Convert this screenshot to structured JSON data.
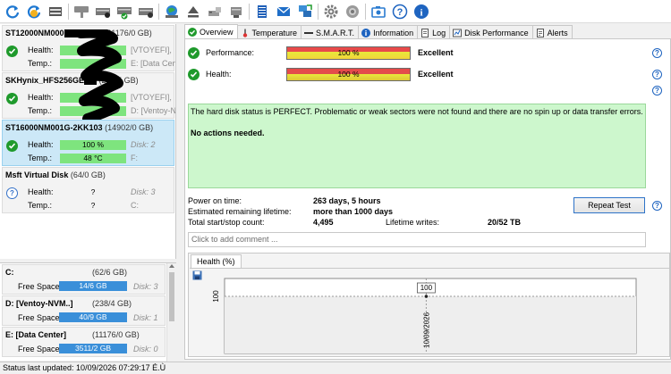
{
  "toolbar": {
    "icons": [
      "refresh-icon",
      "refresh-selected-icon",
      "drive-icon",
      "spindown-icon",
      "drive-ok-icon",
      "drive-check-icon",
      "drive-eject-icon",
      "globe-drive-icon",
      "eject-icon",
      "usb-drive-icon",
      "network-drive-icon",
      "notepad-icon",
      "mail-icon",
      "network-icon",
      "settings-icon",
      "speaker-icon",
      "screenshot-icon",
      "help-icon",
      "info-icon"
    ]
  },
  "disks": [
    {
      "title": "ST12000NM000",
      "title_suffix": "1",
      "capacity": "(11176/0 GB)",
      "health_label": "Health:",
      "health_value": "",
      "health_right": "[VTOYEFI],",
      "temp_label": "Temp.:",
      "temp_value": "",
      "temp_right": "E: [Data Center",
      "status": "ok"
    },
    {
      "title": "SKHynix_HFS256GE",
      "capacity": "(238/5 GB)",
      "health_label": "Health:",
      "health_value": "",
      "health_right": "[VTOYEFI],",
      "temp_label": "Temp.:",
      "temp_value": "",
      "temp_right": "D: [Ventoy-NVM",
      "status": "ok"
    },
    {
      "title": "ST16000NM001G-2KK103",
      "capacity": "(14902/0 GB)",
      "health_label": "Health:",
      "health_value": "100 %",
      "health_right": "Disk: 2",
      "temp_label": "Temp.:",
      "temp_value": "48 °C",
      "temp_right": "F:",
      "status": "ok"
    },
    {
      "title": "Msft    Virtual Disk",
      "capacity": "(64/0 GB)",
      "health_label": "Health:",
      "health_value": "?",
      "health_right": "Disk: 3",
      "temp_label": "Temp.:",
      "temp_value": "?",
      "temp_right": "C:",
      "status": "unknown"
    }
  ],
  "volumes": [
    {
      "name": "C:",
      "capacity": "(62/6 GB)",
      "free_label": "Free Space",
      "free": "14/6 GB",
      "disk": "Disk: 3"
    },
    {
      "name": "D: [Ventoy-NVM..]",
      "capacity": "(238/4 GB)",
      "free_label": "Free Space",
      "free": "40/9 GB",
      "disk": "Disk: 1"
    },
    {
      "name": "E: [Data Center]",
      "capacity": "(11176/0 GB)",
      "free_label": "Free Space",
      "free": "3511/2 GB",
      "disk": "Disk: 0"
    }
  ],
  "status_bar": "Status last updated: 10/09/2026 07:29:17 É.Ù",
  "tabs": [
    {
      "label": "Overview",
      "icon": "check-icon"
    },
    {
      "label": "Temperature",
      "icon": "thermometer-icon"
    },
    {
      "label": "S.M.A.R.T.",
      "icon": "smart-icon"
    },
    {
      "label": "Information",
      "icon": "info-icon"
    },
    {
      "label": "Log",
      "icon": "log-icon"
    },
    {
      "label": "Disk Performance",
      "icon": "performance-icon"
    },
    {
      "label": "Alerts",
      "icon": "alerts-icon"
    }
  ],
  "overview": {
    "performance_label": "Performance:",
    "performance_value": "100 %",
    "performance_rating": "Excellent",
    "health_label": "Health:",
    "health_value": "100 %",
    "health_rating": "Excellent",
    "status_text_1": "The hard disk status is PERFECT. Problematic or weak sectors were not found and there are no spin up or data transfer errors.",
    "status_text_2": "No actions needed.",
    "power_on_label": "Power on time:",
    "power_on_value": "263 days, 5 hours",
    "remaining_label": "Estimated remaining lifetime:",
    "remaining_value": "more than 1000 days",
    "startstop_label": "Total start/stop count:",
    "startstop_value": "4,495",
    "writes_label": "Lifetime writes:",
    "writes_value": "20/52 TB",
    "repeat_button": "Repeat Test",
    "comment_placeholder": "Click to add comment ..."
  },
  "chart_panel": {
    "tab_label": "Health (%)"
  },
  "chart_data": {
    "type": "line",
    "x": [
      "10/09/2026"
    ],
    "values": [
      100
    ],
    "y_tick_labels": [
      "100"
    ],
    "data_labels": [
      "100"
    ],
    "grid": true
  },
  "colors": {
    "selected_disk": "#cce8f7",
    "health_bar": "#7ee47e",
    "volume_bar": "#3a8fd9",
    "status_box": "#cdf7cd",
    "ok_icon": "#1f9a2c"
  }
}
